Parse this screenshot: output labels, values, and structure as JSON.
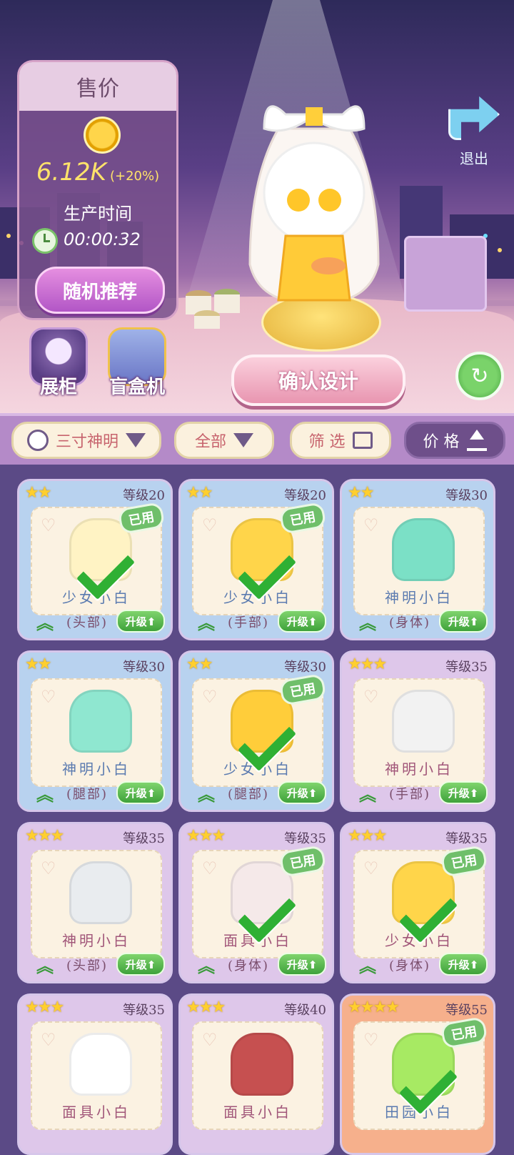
{
  "price_panel": {
    "title": "售价",
    "price": "6.12K",
    "bonus": "(+20%)",
    "time_label": "生产时间",
    "time_value": "00:00:32",
    "random_button": "随机推荐"
  },
  "buttons": {
    "showcase": "展柜",
    "blindbox": "盲盒机",
    "exit": "退出",
    "confirm": "确认设计"
  },
  "filters": {
    "character": "三寸神明",
    "category": "全部",
    "screen": "筛 选",
    "sort": "价 格"
  },
  "cards": [
    {
      "stars": "★★",
      "level": "等级20",
      "name": "少女小白",
      "slot": "(头部)",
      "used": "已用",
      "upgrade": "升级⬆",
      "color": "blue",
      "art": "#fff3c4"
    },
    {
      "stars": "★★",
      "level": "等级20",
      "name": "少女小白",
      "slot": "(手部)",
      "used": "已用",
      "upgrade": "升级⬆",
      "color": "blue",
      "art": "#ffd54a"
    },
    {
      "stars": "★★",
      "level": "等级30",
      "name": "神明小白",
      "slot": "(身体)",
      "used": "",
      "upgrade": "升级⬆",
      "color": "blue",
      "art": "#7be0c6"
    },
    {
      "stars": "★★",
      "level": "等级30",
      "name": "神明小白",
      "slot": "(腿部)",
      "used": "",
      "upgrade": "升级⬆",
      "color": "blue",
      "art": "#8fe7d0"
    },
    {
      "stars": "★★",
      "level": "等级30",
      "name": "少女小白",
      "slot": "(腿部)",
      "used": "已用",
      "upgrade": "升级⬆",
      "color": "blue",
      "art": "#ffcd3a"
    },
    {
      "stars": "★★★",
      "level": "等级35",
      "name": "神明小白",
      "slot": "(手部)",
      "used": "",
      "upgrade": "升级⬆",
      "color": "purple",
      "art": "#f2f2f2"
    },
    {
      "stars": "★★★",
      "level": "等级35",
      "name": "神明小白",
      "slot": "(头部)",
      "used": "",
      "upgrade": "升级⬆",
      "color": "purple",
      "art": "#e9ecef"
    },
    {
      "stars": "★★★",
      "level": "等级35",
      "name": "面具小白",
      "slot": "(身体)",
      "used": "已用",
      "upgrade": "升级⬆",
      "color": "purple",
      "art": "#f5e9e9"
    },
    {
      "stars": "★★★",
      "level": "等级35",
      "name": "少女小白",
      "slot": "(身体)",
      "used": "已用",
      "upgrade": "升级⬆",
      "color": "purple",
      "art": "#ffd54a"
    },
    {
      "stars": "★★★",
      "level": "等级35",
      "name": "面具小白",
      "slot": "",
      "used": "",
      "upgrade": "",
      "color": "purple",
      "art": "#ffffff"
    },
    {
      "stars": "★★★",
      "level": "等级40",
      "name": "面具小白",
      "slot": "",
      "used": "",
      "upgrade": "",
      "color": "purple",
      "art": "#c65050"
    },
    {
      "stars": "★★★★",
      "level": "等级55",
      "name": "田园小白",
      "slot": "",
      "used": "已用",
      "upgrade": "",
      "color": "orange",
      "art": "#a7ea63"
    }
  ]
}
